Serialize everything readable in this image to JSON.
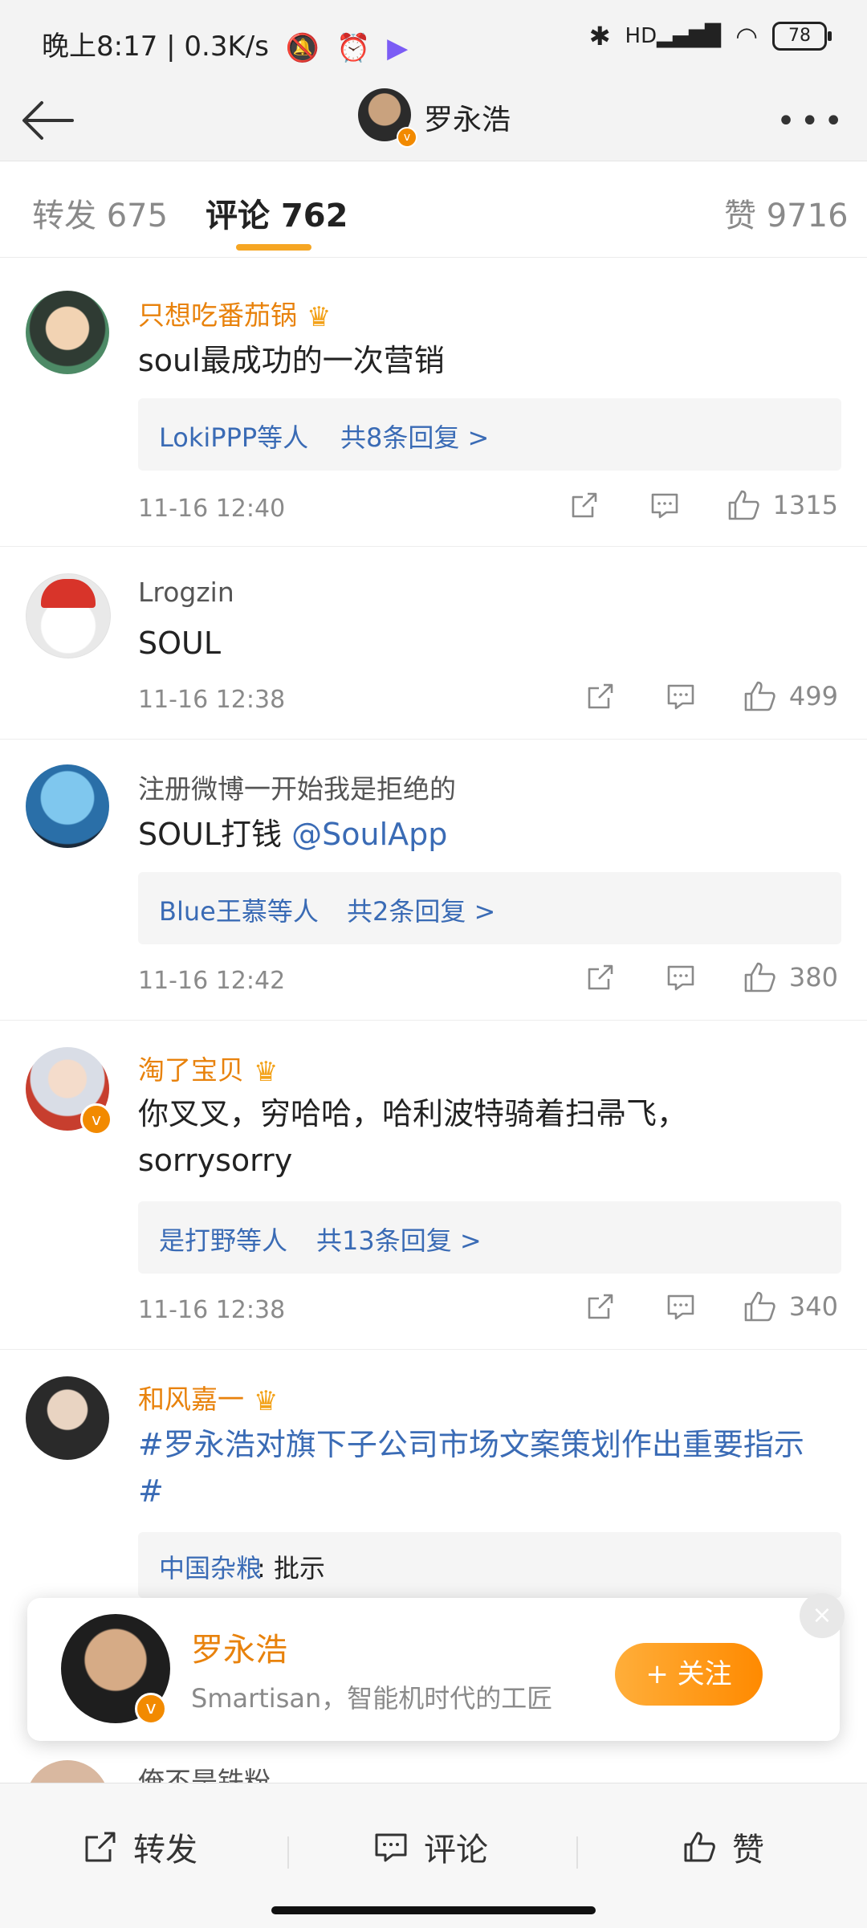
{
  "status_bar": {
    "time": "晚上8:17 | 0.3K/s",
    "battery": "78",
    "network": "HD"
  },
  "header": {
    "title": "罗永浩",
    "verified_badge": "v"
  },
  "tabs": [
    {
      "label": "转发",
      "count": "675"
    },
    {
      "label": "评论",
      "count": "762"
    },
    {
      "label": "赞",
      "count": "9716"
    }
  ],
  "comments": [
    {
      "name": "只想吃番茄锅",
      "vip": true,
      "text": "soul最成功的一次营销",
      "reply_names": "LokiPPP等人",
      "reply_count": "共8条回复 >",
      "time": "11-16 12:40",
      "likes": "1315"
    },
    {
      "name": "Lrogzin",
      "vip": false,
      "text": "SOUL",
      "time": "11-16 12:38",
      "likes": "499"
    },
    {
      "name": "注册微博一开始我是拒绝的",
      "vip": false,
      "text": "SOUL打钱",
      "mention": "@SoulApp",
      "reply_names": "Blue王慕等人",
      "reply_count": "共2条回复 >",
      "time": "11-16 12:42",
      "likes": "380"
    },
    {
      "name": "淘了宝贝",
      "vip": true,
      "text": "你叉叉，穷哈哈，哈利波特骑着扫帚飞，sorrysorry",
      "reply_names": "是打野等人",
      "reply_count": "共13条回复 >",
      "time": "11-16 12:38",
      "likes": "340"
    },
    {
      "name": "和风嘉一",
      "vip": true,
      "text": "#罗永浩对旗下子公司市场文案策划作出重要指示#",
      "reply_author": "中国杂粮",
      "reply_text": ": 批示"
    },
    {
      "name": "俺不是铁粉"
    }
  ],
  "follow_card": {
    "name": "罗永浩",
    "desc": "Smartisan，智能机时代的工匠",
    "button": "+ 关注",
    "close": "×"
  },
  "bottom_bar": {
    "repost": "转发",
    "comment": "评论",
    "like": "赞"
  }
}
